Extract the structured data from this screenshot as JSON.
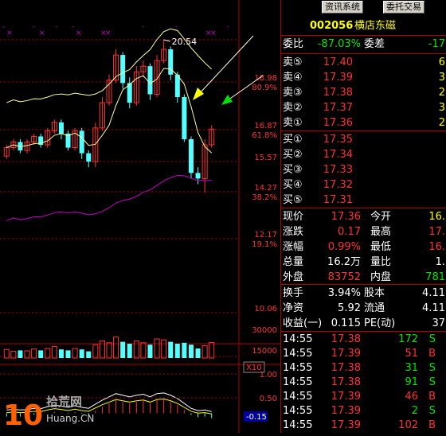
{
  "toolbar": {
    "btn1": "资讯系统",
    "btn2": "委托交易"
  },
  "stock": {
    "code": "002056",
    "name": "横店东磁"
  },
  "ratio": {
    "label": "委比",
    "value": "-87.03%",
    "diff_label": "委差",
    "diff_value": "-17"
  },
  "sells": [
    {
      "label": "卖⑤",
      "price": "17.40",
      "vol": "6"
    },
    {
      "label": "卖④",
      "price": "17.39",
      "vol": "3"
    },
    {
      "label": "卖③",
      "price": "17.38",
      "vol": "2"
    },
    {
      "label": "卖②",
      "price": "17.37",
      "vol": "3"
    },
    {
      "label": "卖①",
      "price": "17.36",
      "vol": "2"
    }
  ],
  "buys": [
    {
      "label": "买①",
      "price": "17.35"
    },
    {
      "label": "买②",
      "price": "17.34"
    },
    {
      "label": "买③",
      "price": "17.33"
    },
    {
      "label": "买④",
      "price": "17.32"
    },
    {
      "label": "买⑤",
      "price": "17.31"
    }
  ],
  "quote": [
    {
      "l1": "现价",
      "v1": "17.36",
      "l2": "今开",
      "v2": "16."
    },
    {
      "l1": "涨跌",
      "v1": "0.17",
      "l2": "最高",
      "v2": "17."
    },
    {
      "l1": "涨幅",
      "v1": "0.99%",
      "l2": "最低",
      "v2": "16."
    },
    {
      "l1": "总量",
      "v1": "16.2万",
      "l2": "量比",
      "v2": "1."
    },
    {
      "l1": "外盘",
      "v1": "83752",
      "l2": "内盘",
      "v2": "781"
    }
  ],
  "fin": [
    {
      "l1": "换手",
      "v1": "3.94%",
      "l2": "股本",
      "v2": "4.11"
    },
    {
      "l1": "净资",
      "v1": "5.92",
      "l2": "流通",
      "v2": "4.11"
    },
    {
      "l1": "收益(一)",
      "v1": "0.115",
      "l2": "PE(动)",
      "v2": "37"
    }
  ],
  "ticks": [
    {
      "t": "14:55",
      "p": "17.38",
      "v": "172",
      "s": "S"
    },
    {
      "t": "14:55",
      "p": "17.39",
      "v": "51",
      "s": "B"
    },
    {
      "t": "14:55",
      "p": "17.38",
      "v": "31",
      "s": "S"
    },
    {
      "t": "14:55",
      "p": "17.38",
      "v": "91",
      "s": "S"
    },
    {
      "t": "14:55",
      "p": "17.39",
      "v": "46",
      "s": "B"
    },
    {
      "t": "14:55",
      "p": "17.39",
      "v": "2",
      "s": "S"
    },
    {
      "t": "14:55",
      "p": "17.39",
      "v": "102",
      "s": "B"
    }
  ],
  "price_axis": [
    {
      "price": "18.98",
      "pct": "80.9%"
    },
    {
      "price": "16.87",
      "pct": "61.8%"
    },
    {
      "price": "15.57",
      "pct": ""
    },
    {
      "price": "14.27",
      "pct": "38.2%"
    },
    {
      "price": "12.17",
      "pct": "19.1%"
    },
    {
      "price": "10.06",
      "pct": ""
    }
  ],
  "peak_label": "20.54",
  "vol_axis": [
    "30000",
    "15000"
  ],
  "vol_unit": "X10",
  "macd_axis": [
    "1.00",
    "0.50"
  ],
  "macd_value": "-0.15",
  "watermark": {
    "num": "10",
    "text": "拾荒网",
    "url": "Huang.CN"
  },
  "colors": {
    "up": "#ff3232",
    "down": "#54ffff",
    "grid": "#b00000",
    "ma": "#ffff99",
    "ma2": "#c000c0"
  },
  "chart_data": {
    "type": "candlestick",
    "price_range": [
      10.06,
      20.54
    ],
    "candles": [
      {
        "o": 16.4,
        "c": 16.7,
        "h": 16.8,
        "l": 16.3
      },
      {
        "o": 16.7,
        "c": 16.9,
        "h": 17.0,
        "l": 16.6
      },
      {
        "o": 16.9,
        "c": 16.6,
        "h": 17.0,
        "l": 16.5
      },
      {
        "o": 16.6,
        "c": 16.9,
        "h": 17.0,
        "l": 16.5
      },
      {
        "o": 16.9,
        "c": 17.1,
        "h": 17.2,
        "l": 16.8
      },
      {
        "o": 17.1,
        "c": 16.8,
        "h": 17.2,
        "l": 16.7
      },
      {
        "o": 16.8,
        "c": 17.3,
        "h": 17.4,
        "l": 16.7
      },
      {
        "o": 17.3,
        "c": 17.6,
        "h": 17.7,
        "l": 17.2
      },
      {
        "o": 17.6,
        "c": 17.2,
        "h": 17.7,
        "l": 17.0
      },
      {
        "o": 17.2,
        "c": 16.7,
        "h": 17.3,
        "l": 16.6
      },
      {
        "o": 16.7,
        "c": 17.3,
        "h": 17.4,
        "l": 16.6
      },
      {
        "o": 17.3,
        "c": 16.5,
        "h": 17.4,
        "l": 16.3
      },
      {
        "o": 16.5,
        "c": 16.2,
        "h": 16.6,
        "l": 16.0
      },
      {
        "o": 16.2,
        "c": 17.4,
        "h": 17.6,
        "l": 16.0
      },
      {
        "o": 17.4,
        "c": 18.3,
        "h": 18.5,
        "l": 17.3
      },
      {
        "o": 18.3,
        "c": 19.1,
        "h": 19.3,
        "l": 18.2
      },
      {
        "o": 19.1,
        "c": 20.0,
        "h": 20.2,
        "l": 19.0
      },
      {
        "o": 20.0,
        "c": 19.0,
        "h": 20.1,
        "l": 18.8
      },
      {
        "o": 19.0,
        "c": 18.3,
        "h": 19.2,
        "l": 18.1
      },
      {
        "o": 18.3,
        "c": 19.4,
        "h": 19.6,
        "l": 18.2
      },
      {
        "o": 19.4,
        "c": 19.6,
        "h": 19.8,
        "l": 19.2
      },
      {
        "o": 19.6,
        "c": 18.6,
        "h": 19.7,
        "l": 18.4
      },
      {
        "o": 18.6,
        "c": 19.8,
        "h": 20.0,
        "l": 18.5
      },
      {
        "o": 19.8,
        "c": 20.2,
        "h": 20.54,
        "l": 19.7
      },
      {
        "o": 20.2,
        "c": 19.3,
        "h": 20.3,
        "l": 19.1
      },
      {
        "o": 19.3,
        "c": 18.5,
        "h": 19.4,
        "l": 18.3
      },
      {
        "o": 18.5,
        "c": 17.0,
        "h": 18.6,
        "l": 16.9
      },
      {
        "o": 17.0,
        "c": 15.8,
        "h": 17.1,
        "l": 15.6
      },
      {
        "o": 15.8,
        "c": 15.6,
        "h": 16.0,
        "l": 15.4
      },
      {
        "o": 15.6,
        "c": 16.8,
        "h": 17.0,
        "l": 15.1
      },
      {
        "o": 16.8,
        "c": 17.36,
        "h": 17.5,
        "l": 16.7
      }
    ],
    "volume_range": [
      0,
      30000
    ],
    "volumes": [
      9000,
      7000,
      8000,
      7500,
      9500,
      8000,
      10000,
      12000,
      9000,
      8000,
      10000,
      9000,
      7000,
      14000,
      18000,
      16000,
      22000,
      17000,
      15000,
      18000,
      16000,
      14000,
      20000,
      19000,
      17000,
      15000,
      16000,
      14000,
      10000,
      13000,
      16200
    ],
    "macd_range": [
      -0.5,
      1.2
    ],
    "macd": [
      -0.1,
      -0.08,
      -0.1,
      -0.09,
      -0.05,
      -0.06,
      0.0,
      0.05,
      0.02,
      -0.02,
      0.03,
      -0.02,
      -0.05,
      0.08,
      0.2,
      0.3,
      0.4,
      0.35,
      0.3,
      0.35,
      0.38,
      0.3,
      0.4,
      0.42,
      0.35,
      0.25,
      0.1,
      -0.05,
      -0.12,
      -0.1,
      -0.15
    ]
  }
}
